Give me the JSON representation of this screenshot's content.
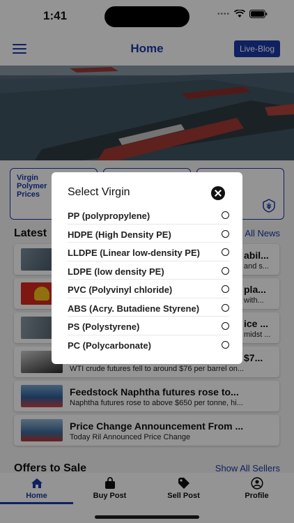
{
  "status": {
    "time": "1:41"
  },
  "header": {
    "title": "Home",
    "live_blog_label": "Live-Blog"
  },
  "categories": [
    {
      "label_lines": [
        "Virgin",
        "Polymer",
        "Prices"
      ]
    },
    {
      "label_lines": []
    },
    {
      "label_lines": []
    }
  ],
  "latest": {
    "heading": "Latest",
    "all_news": "All News"
  },
  "news": [
    {
      "title": "abil...",
      "sub": "and s..."
    },
    {
      "title": "pla...",
      "sub": "with..."
    },
    {
      "title": "ice ...",
      "sub": "midst ..."
    },
    {
      "title": "$7...",
      "sub": "WTI crude futures fell to around $76 per barrel on..."
    },
    {
      "title": "Feedstock Naphtha futures rose to...",
      "sub": "Naphtha futures rose to above $650 per tonne, hi..."
    },
    {
      "title": "Price Change Announcement From ...",
      "sub": "Today Ril Announced Price Change"
    }
  ],
  "offers": {
    "heading": "Offers to Sale",
    "show_all": "Show All Sellers"
  },
  "tabs": [
    {
      "label": "Home",
      "icon": "home-icon",
      "active": true
    },
    {
      "label": "Buy Post",
      "icon": "shopping-bag-icon",
      "active": false
    },
    {
      "label": "Sell Post",
      "icon": "tag-icon",
      "active": false
    },
    {
      "label": "Profile",
      "icon": "user-circle-icon",
      "active": false
    }
  ],
  "modal": {
    "title": "Select Virgin",
    "options": [
      "PP (polypropylene)",
      "HDPE (High Density PE)",
      "LLDPE (Linear low-density PE)",
      "LDPE (low density PE)",
      "PVC (Polyvinyl chloride)",
      "ABS (Acry. Butadiene Styrene)",
      "PS (Polystyrene)",
      "PC (Polycarbonate)"
    ]
  },
  "colors": {
    "brand": "#1a3aa8",
    "overlay": "rgba(0,0,0,0.42)"
  }
}
